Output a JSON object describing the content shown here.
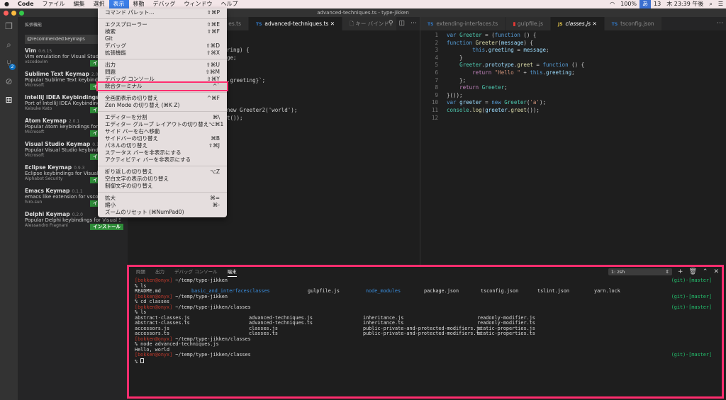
{
  "menubar": {
    "apple": "",
    "items": [
      "Code",
      "ファイル",
      "編集",
      "選択",
      "表示",
      "移動",
      "デバッグ",
      "ウィンドウ",
      "ヘルプ"
    ],
    "active": "表示",
    "status": [
      "100%",
      "あ",
      "13",
      "木 23:39 午後"
    ]
  },
  "window": {
    "title": "advanced-techniques.ts - type-jikken"
  },
  "activity": {
    "scm_badge": "2"
  },
  "sidebar": {
    "header": "拡張機能",
    "search": "@recommended:keymaps",
    "install_label": "インストール",
    "items": [
      {
        "name": "Vim",
        "version": "0.6.15",
        "desc": "Vim emulation for Visual Studio Code",
        "publisher": "vscodevim"
      },
      {
        "name": "Sublime Text Keymap",
        "version": "2.0.1",
        "desc": "Popular Sublime Text keybindings for VS Code",
        "publisher": "Microsoft"
      },
      {
        "name": "IntelliJ IDEA Keybindings",
        "version": "0.2.1",
        "desc": "Port of IntelliJ IDEA Keybindings",
        "publisher": "Keisuke Kato"
      },
      {
        "name": "Atom Keymap",
        "version": "2.0.1",
        "desc": "Popular Atom keybindings for VS Code",
        "publisher": "Microsoft"
      },
      {
        "name": "Visual Studio Keymap",
        "version": "0.1.3",
        "desc": "Popular Visual Studio keybindings for VS Code",
        "publisher": "Microsoft"
      },
      {
        "name": "Eclipse Keymap",
        "version": "0.9.3",
        "desc": "Eclipse keybindings for Visual Studio Code",
        "publisher": "Alphabot Security"
      },
      {
        "name": "Emacs Keymap",
        "version": "0.1.1",
        "desc": "emacs like extension for vscode",
        "publisher": "hiro-sun"
      },
      {
        "name": "Delphi Keymap",
        "version": "0.2.0",
        "desc": "Popular Delphi keybindings for Visual St...",
        "publisher": "Alessandro Fragnani"
      }
    ]
  },
  "menu": {
    "groups": [
      [
        {
          "label": "コマンド パレット...",
          "key": "⇧⌘P"
        }
      ],
      [
        {
          "label": "エクスプローラー",
          "key": "⇧⌘E"
        },
        {
          "label": "検索",
          "key": "⇧⌘F"
        },
        {
          "label": "Git",
          "key": ""
        },
        {
          "label": "デバッグ",
          "key": "⇧⌘D"
        },
        {
          "label": "拡張機能",
          "key": "⇧⌘X"
        }
      ],
      [
        {
          "label": "出力",
          "key": "⇧⌘U"
        },
        {
          "label": "問題",
          "key": "⇧⌘M"
        },
        {
          "label": "デバッグ コンソール",
          "key": "⇧⌘Y"
        },
        {
          "label": "統合ターミナル",
          "key": "^`"
        }
      ],
      [
        {
          "label": "全画面表示の切り替え",
          "key": "^⌘F"
        },
        {
          "label": "Zen Mode の切り替え (⌘K Z)",
          "key": ""
        }
      ],
      [
        {
          "label": "エディターを分割",
          "key": "⌘\\"
        },
        {
          "label": "エディター グループ レイアウトの切り替え",
          "key": "⌥⌘1"
        },
        {
          "label": "サイド バーを右へ移動",
          "key": ""
        },
        {
          "label": "サイドバーの切り替え",
          "key": "⌘B"
        },
        {
          "label": "パネルの切り替え",
          "key": "⇧⌘J"
        },
        {
          "label": "ステータス バーを非表示にする",
          "key": ""
        },
        {
          "label": "アクティビティ バーを非表示にする",
          "key": ""
        }
      ],
      [
        {
          "label": "折り返しの切り替え",
          "key": "⌥Z"
        },
        {
          "label": "空白文字の表示の切り替え",
          "key": ""
        },
        {
          "label": "制御文字の切り替え",
          "key": ""
        }
      ],
      [
        {
          "label": "拡大",
          "key": "⌘="
        },
        {
          "label": "縮小",
          "key": "⌘-"
        },
        {
          "label": "ズームのリセット (⌘NumPad0)",
          "key": ""
        }
      ]
    ]
  },
  "editor1": {
    "tabs": [
      {
        "label": "es.ts",
        "type": "TS"
      },
      {
        "label": "advanced-techniques.ts",
        "type": "TS",
        "active": true
      },
      {
        "label": "キー バインド",
        "type": ""
      }
    ],
    "lines": [
      "",
      "",
      "ring) {",
      "ge;",
      "",
      "",
      ".greeting}`;",
      "",
      "",
      "",
      "new Greeter2('world');",
      "t());"
    ]
  },
  "editor2": {
    "tabs": [
      {
        "label": "extending-interfaces.ts",
        "type": "TS"
      },
      {
        "label": "gulpfile.js",
        "type": "gulp"
      },
      {
        "label": "classes.js",
        "type": "JS",
        "active": true
      },
      {
        "label": "tsconfig.json",
        "type": "TS"
      }
    ]
  },
  "panel": {
    "tabs": [
      "問題",
      "出力",
      "デバッグ コンソール",
      "端末"
    ],
    "active": "端末",
    "terminal_select": "1: zsh",
    "prompt": "[bokken@onyx]",
    "git": "(git)-[master]",
    "lines": {
      "p1": " ~/temp/type-jikken",
      "c1": "% ls",
      "ls1": [
        "README.md",
        "basic_and_interfaces",
        "classes",
        "gulpfile.js",
        "node_modules",
        "package.json",
        "tsconfig.json",
        "tslint.json",
        "yarn.lock"
      ],
      "p2": " ~/temp/type-jikken",
      "c2": "% cd classes",
      "p3": " ~/temp/type-jikken/classes",
      "c3": "% ls",
      "ls2": [
        [
          "abstract-classes.js",
          "advanced-techniques.js",
          "inheritance.js",
          "readonly-modifier.js"
        ],
        [
          "abstract-classes.ts",
          "advanced-techniques.ts",
          "inheritance.ts",
          "readonly-modifier.ts"
        ],
        [
          "accessors.js",
          "classes.js",
          "public-private-and-protected-modifiers.js",
          "static-properties.js"
        ],
        [
          "accessors.ts",
          "classes.ts",
          "public-private-and-protected-modifiers.ts",
          "static-properties.ts"
        ]
      ],
      "p4": " ~/temp/type-jikken/classes",
      "c4": "% node advanced-techniques.js",
      "out": "Hello, world",
      "p5": " ~/temp/type-jikken/classes",
      "c5": "% "
    }
  },
  "colors": {
    "highlight": "#ff2d6e",
    "install": "#2e8b38",
    "accent": "#3b7ee8"
  }
}
